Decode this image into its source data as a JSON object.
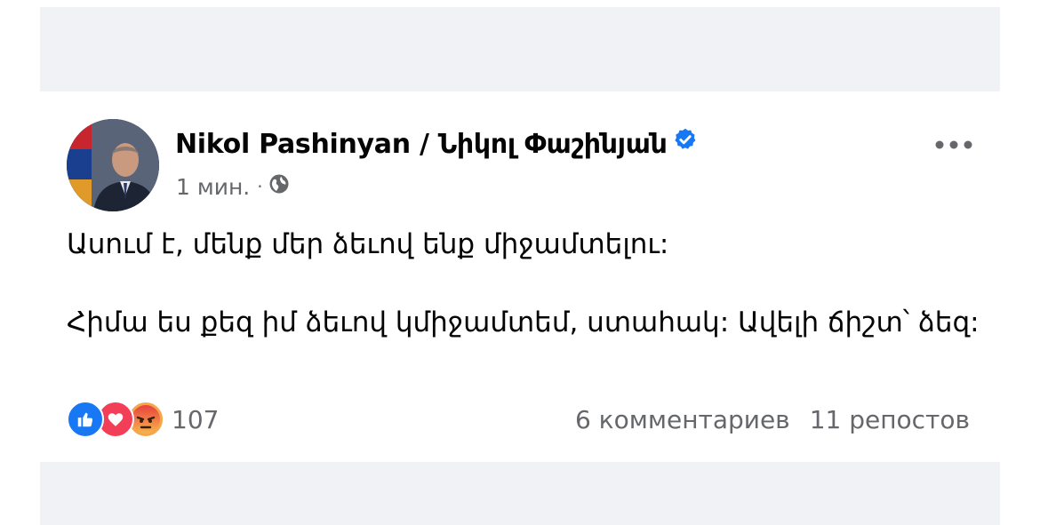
{
  "post": {
    "author": "Nikol Pashinyan / Նիկոլ Փաշինյան",
    "verified": true,
    "time": "1 мин.",
    "separator": "·",
    "privacy_icon": "globe-icon",
    "more_icon": "more-dots-icon",
    "paragraphs": [
      "Ասում է, մենք մեր ձեւով ենք միջամտելու:",
      "Հիմա ես քեզ իմ ձեւով կմիջամտեմ, ստահակ: Ավելի ճիշտ՝ ձեզ:"
    ],
    "reactions": {
      "icons": [
        "like-icon",
        "love-icon",
        "angry-icon"
      ],
      "count": "107"
    },
    "comments": "6 комментариев",
    "shares": "11 репостов"
  },
  "colors": {
    "background_band": "#f0f2f5",
    "text_primary": "#050505",
    "text_secondary": "#65676b",
    "verified_blue": "#1877f2",
    "like_blue": "#1877f2",
    "love_red": "#f33e58",
    "angry_orange": "#f5a64a"
  }
}
